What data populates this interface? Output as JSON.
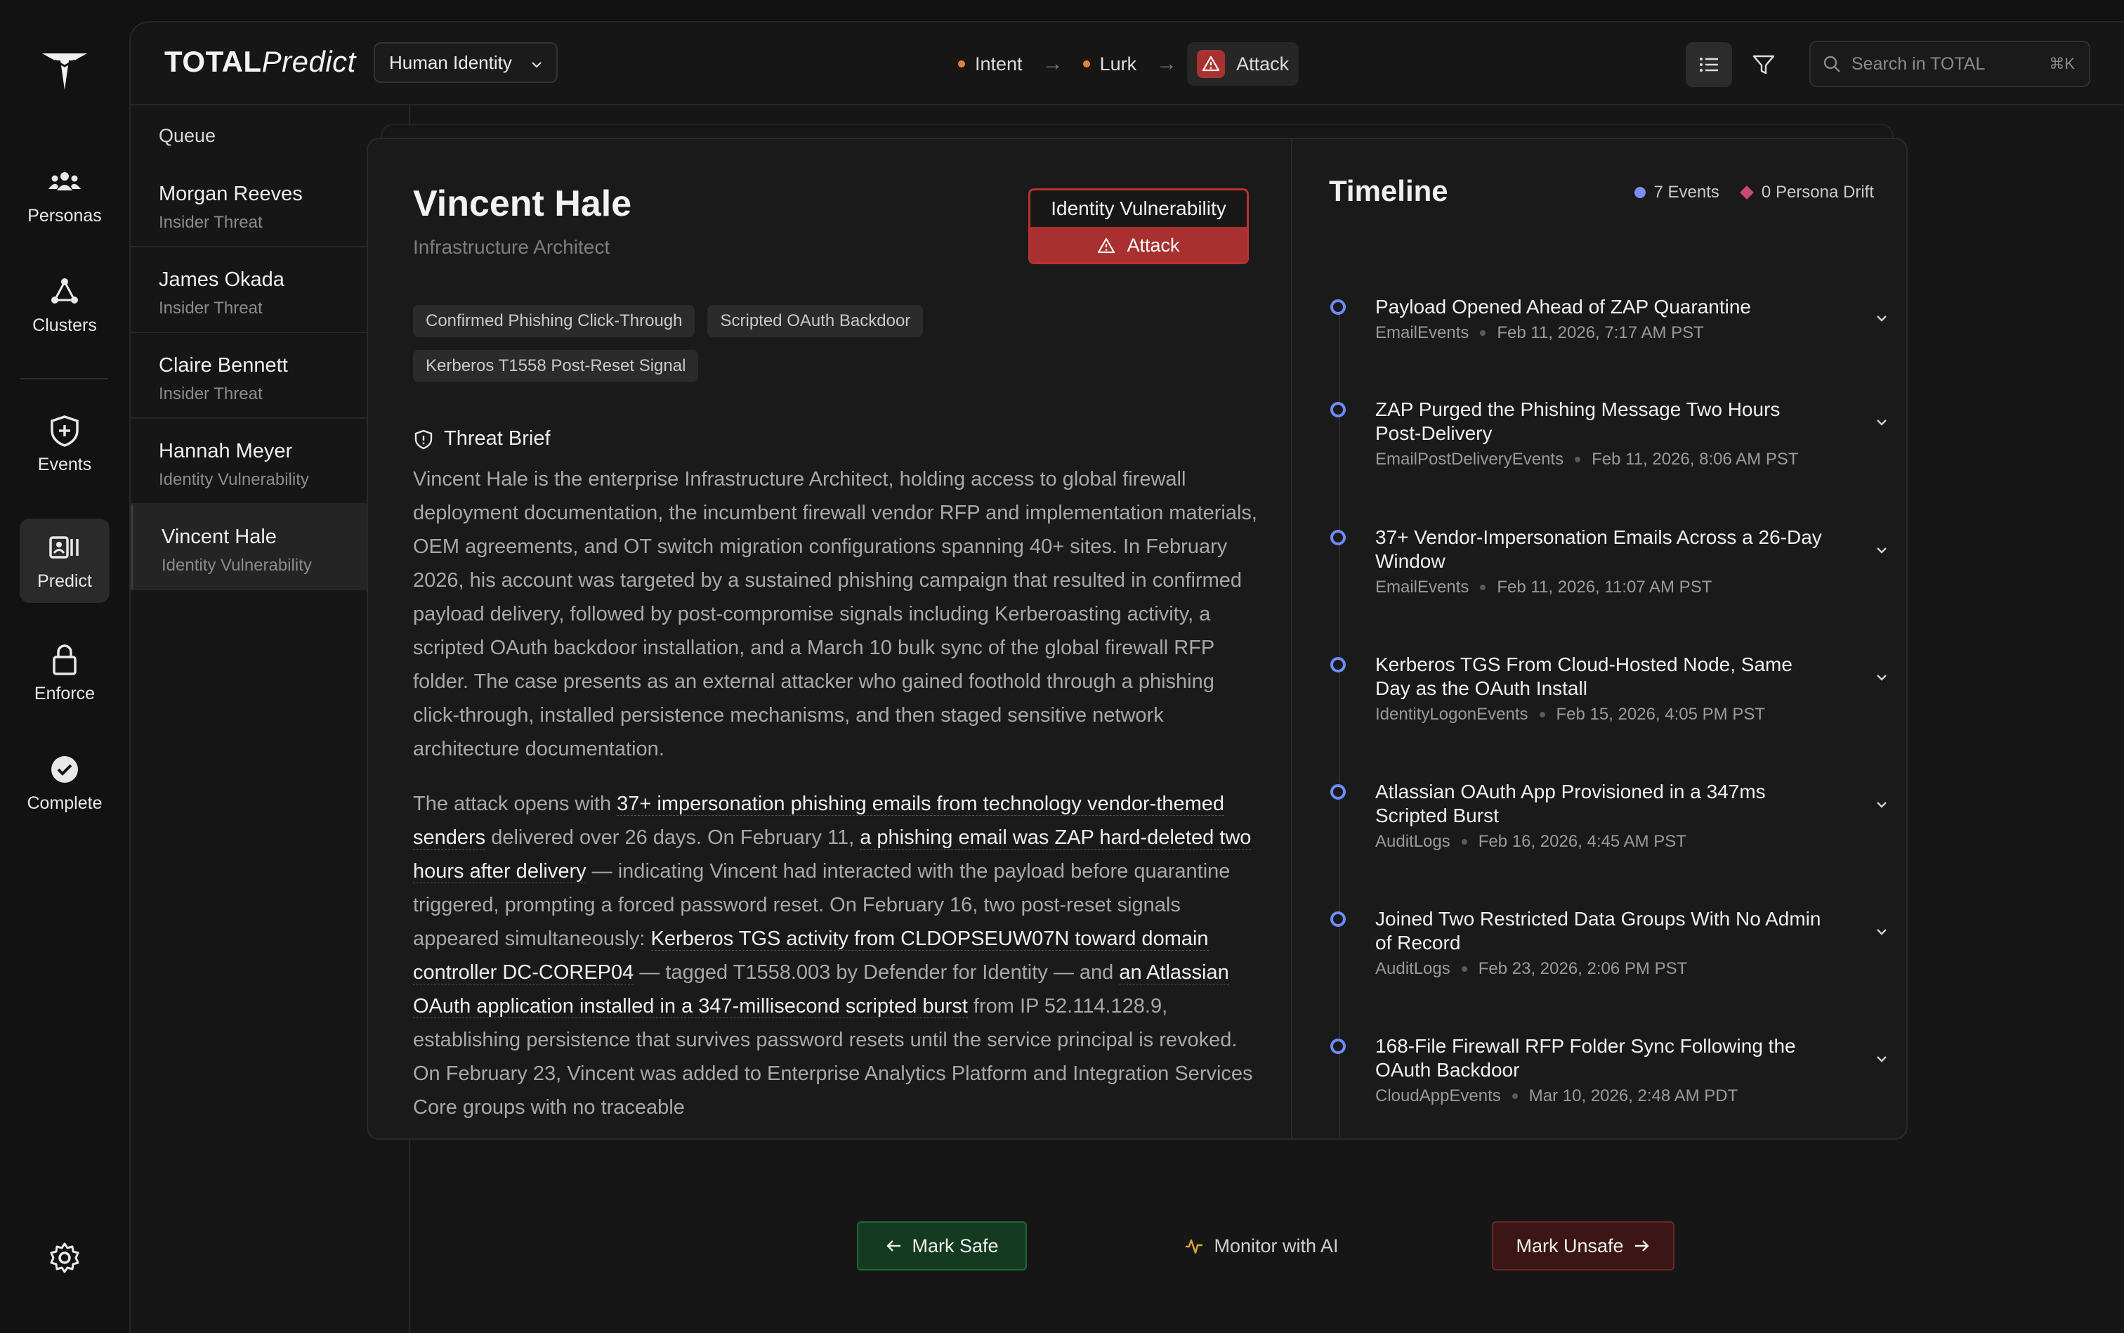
{
  "app": {
    "brand_bold": "TOTAL",
    "brand_italic": "Predict",
    "context": "Human Identity",
    "search_placeholder": "Search in TOTAL",
    "search_shortcut": "⌘K"
  },
  "rail": {
    "items": [
      {
        "label": "Personas",
        "icon": "people-icon"
      },
      {
        "label": "Clusters",
        "icon": "network-icon"
      },
      {
        "label": "Events",
        "icon": "shield-plus-icon"
      },
      {
        "label": "Predict",
        "icon": "predict-icon"
      },
      {
        "label": "Enforce",
        "icon": "lock-icon"
      },
      {
        "label": "Complete",
        "icon": "check-circle-icon"
      }
    ],
    "active": "Predict"
  },
  "stages": [
    {
      "label": "Intent",
      "color": "#e8823a"
    },
    {
      "label": "Lurk",
      "color": "#e8823a"
    },
    {
      "label": "Attack",
      "active": true,
      "color": "#a83232"
    }
  ],
  "queue": {
    "title": "Queue",
    "items": [
      {
        "name": "Morgan Reeves",
        "type": "Insider Threat"
      },
      {
        "name": "James Okada",
        "type": "Insider Threat"
      },
      {
        "name": "Claire Bennett",
        "type": "Insider Threat"
      },
      {
        "name": "Hannah Meyer",
        "type": "Identity Vulnerability"
      },
      {
        "name": "Vincent Hale",
        "type": "Identity Vulnerability",
        "active": true
      }
    ]
  },
  "detail": {
    "name": "Vincent Hale",
    "role": "Infrastructure Architect",
    "risk_category": "Identity Vulnerability",
    "risk_stage": "Attack",
    "tags": [
      "Confirmed Phishing Click-Through",
      "Scripted OAuth Backdoor",
      "Kerberos T1558 Post-Reset Signal"
    ],
    "brief_title": "Threat Brief",
    "brief_p1": "Vincent Hale is the enterprise Infrastructure Architect, holding access to global firewall deployment documentation, the incumbent firewall vendor RFP and implementation materials, OEM agreements, and OT switch migration configurations spanning 40+ sites. In February 2026, his account was targeted by a sustained phishing campaign that resulted in confirmed payload delivery, followed by post-compromise signals including Kerberoasting activity, a scripted OAuth backdoor installation, and a March 10 bulk sync of the global firewall RFP folder. The case presents as an external attacker who gained foothold through a phishing click-through, installed persistence mechanisms, and then staged sensitive network architecture documentation.",
    "brief_p2": {
      "s1": "The attack opens with ",
      "h1": "37+ impersonation phishing emails from technology vendor-themed senders",
      "s2": " delivered over 26 days. On February 11, ",
      "h2": "a phishing email was ZAP hard-deleted two hours after delivery",
      "s3": " — indicating Vincent had interacted with the payload before quarantine triggered, prompting a forced password reset. On February 16, two post-reset signals appeared simultaneously: ",
      "h3": "Kerberos TGS activity from CLDOPSEUW07N toward domain controller DC-COREP04",
      "s4": " — tagged T1558.003 by Defender for Identity — and ",
      "h4": "an Atlassian OAuth application installed in a 347-millisecond scripted burst",
      "s5": " from IP 52.114.128.9, establishing persistence that survives password resets until the service principal is revoked. On February 23, Vincent was added to Enterprise Analytics Platform and Integration Services Core groups with no traceable"
    }
  },
  "timeline": {
    "title": "Timeline",
    "events_count": "7 Events",
    "drift_count": "0 Persona Drift",
    "events_color": "#7e8ef0",
    "drift_color": "#d0457c",
    "items": [
      {
        "title": "Payload Opened Ahead of ZAP Quarantine",
        "source": "EmailEvents",
        "time": "Feb 11, 2026, 7:17 AM PST"
      },
      {
        "title": "ZAP Purged the Phishing Message Two Hours Post-Delivery",
        "source": "EmailPostDeliveryEvents",
        "time": "Feb 11, 2026, 8:06 AM PST"
      },
      {
        "title": "37+ Vendor-Impersonation Emails Across a 26-Day Window",
        "source": "EmailEvents",
        "time": "Feb 11, 2026, 11:07 AM PST"
      },
      {
        "title": "Kerberos TGS From Cloud-Hosted Node, Same Day as the OAuth Install",
        "source": "IdentityLogonEvents",
        "time": "Feb 15, 2026, 4:05 PM PST"
      },
      {
        "title": "Atlassian OAuth App Provisioned in a 347ms Scripted Burst",
        "source": "AuditLogs",
        "time": "Feb 16, 2026, 4:45 AM PST"
      },
      {
        "title": "Joined Two Restricted Data Groups With No Admin of Record",
        "source": "AuditLogs",
        "time": "Feb 23, 2026, 2:06 PM PST"
      },
      {
        "title": "168-File Firewall RFP Folder Sync Following the OAuth Backdoor",
        "source": "CloudAppEvents",
        "time": "Mar 10, 2026, 2:48 AM PDT"
      }
    ]
  },
  "actions": {
    "safe": "Mark Safe",
    "monitor": "Monitor with AI",
    "unsafe": "Mark Unsafe"
  }
}
